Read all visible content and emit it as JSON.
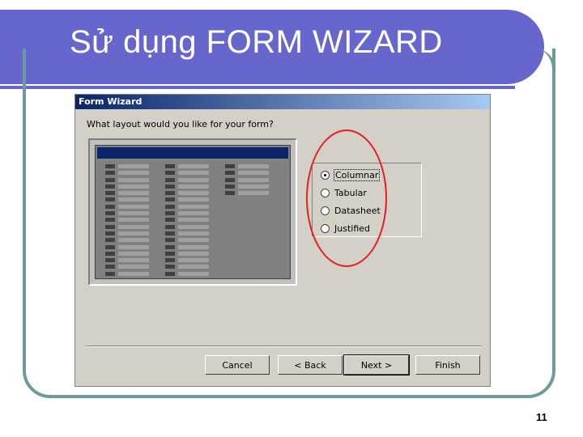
{
  "slide": {
    "title": "Sử dụng FORM WIZARD",
    "page_number": "11"
  },
  "dialog": {
    "title": "Form Wizard",
    "question": "What layout would you like for your form?",
    "layout_options": [
      {
        "label": "Columnar",
        "selected": true
      },
      {
        "label": "Tabular",
        "selected": false
      },
      {
        "label": "Datasheet",
        "selected": false
      },
      {
        "label": "Justified",
        "selected": false
      }
    ],
    "buttons": {
      "cancel": "Cancel",
      "back": "< Back",
      "next": "Next >",
      "finish": "Finish"
    }
  },
  "colors": {
    "title_bar": "#6666cc",
    "frame": "#6f9a9a",
    "highlight_circle": "#e02020",
    "dialog_bg": "#d4d0c8"
  }
}
